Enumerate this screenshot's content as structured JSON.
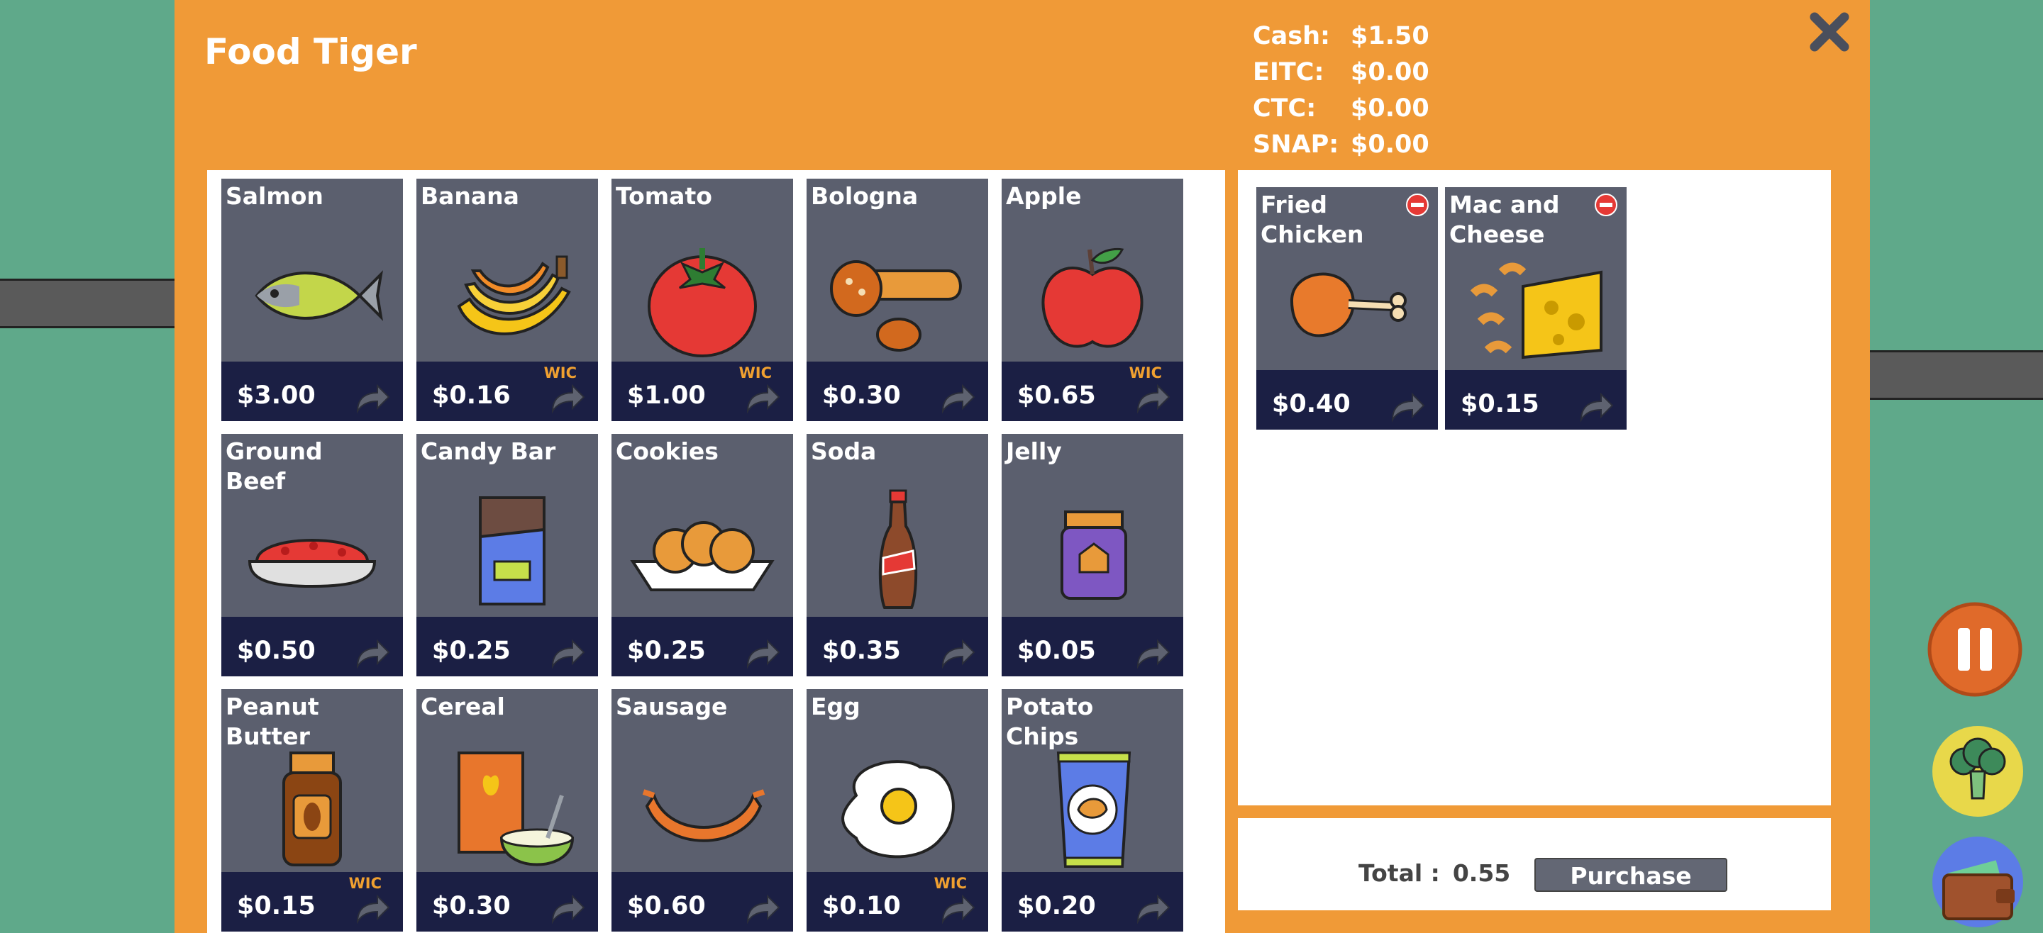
{
  "store": {
    "title": "Food Tiger",
    "items": [
      {
        "name": "Salmon",
        "price": "$3.00",
        "wic": "",
        "icon": "salmon-icon"
      },
      {
        "name": "Banana",
        "price": "$0.16",
        "wic": "WIC",
        "icon": "banana-icon"
      },
      {
        "name": "Tomato",
        "price": "$1.00",
        "wic": "WIC",
        "icon": "tomato-icon"
      },
      {
        "name": "Bologna",
        "price": "$0.30",
        "wic": "",
        "icon": "bologna-icon"
      },
      {
        "name": "Apple",
        "price": "$0.65",
        "wic": "WIC",
        "icon": "apple-icon"
      },
      {
        "name": "Ground Beef",
        "price": "$0.50",
        "wic": "",
        "icon": "ground-beef-icon"
      },
      {
        "name": "Candy Bar",
        "price": "$0.25",
        "wic": "",
        "icon": "candy-bar-icon"
      },
      {
        "name": "Cookies",
        "price": "$0.25",
        "wic": "",
        "icon": "cookies-icon"
      },
      {
        "name": "Soda",
        "price": "$0.35",
        "wic": "",
        "icon": "soda-icon"
      },
      {
        "name": "Jelly",
        "price": "$0.05",
        "wic": "",
        "icon": "jelly-icon"
      },
      {
        "name": "Peanut Butter",
        "price": "$0.15",
        "wic": "WIC",
        "icon": "peanut-butter-icon"
      },
      {
        "name": "Cereal",
        "price": "$0.30",
        "wic": "",
        "icon": "cereal-icon"
      },
      {
        "name": "Sausage",
        "price": "$0.60",
        "wic": "",
        "icon": "sausage-icon"
      },
      {
        "name": "Egg",
        "price": "$0.10",
        "wic": "WIC",
        "icon": "egg-icon"
      },
      {
        "name": "Potato Chips",
        "price": "$0.20",
        "wic": "",
        "icon": "potato-chips-icon"
      }
    ]
  },
  "balances": [
    {
      "label": "Cash:",
      "value": "$1.50"
    },
    {
      "label": "EITC:",
      "value": "$0.00"
    },
    {
      "label": "CTC:",
      "value": "$0.00"
    },
    {
      "label": "SNAP:",
      "value": "$0.00"
    }
  ],
  "cart": {
    "items": [
      {
        "name": "Fried Chicken",
        "price": "$0.40",
        "icon": "fried-chicken-icon"
      },
      {
        "name": "Mac and Cheese",
        "price": "$0.15",
        "icon": "mac-and-cheese-icon"
      }
    ],
    "total_label": "Total :",
    "total_value": "0.55",
    "purchase_label": "Purchase"
  },
  "colors": {
    "background": "#5fa98a",
    "modal": "#f09a37",
    "tile": "#5b5f6e",
    "price_bar": "#1b1f44",
    "wic": "#f0a030",
    "pause": "#e06a2a"
  }
}
